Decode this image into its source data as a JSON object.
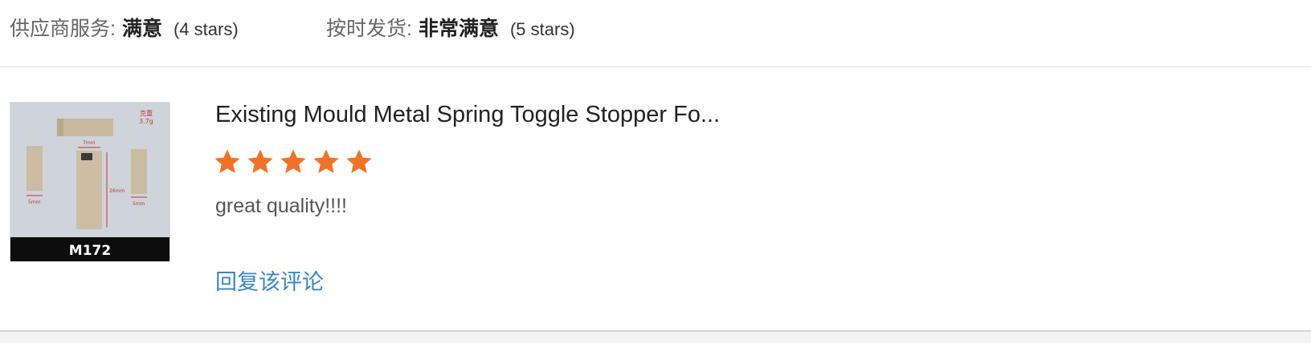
{
  "ratings": {
    "supplier_service": {
      "label": "供应商服务:",
      "value": "满意",
      "stars_text": "(4 stars)"
    },
    "on_time_delivery": {
      "label": "按时发货:",
      "value": "非常满意",
      "stars_text": "(5 stars)"
    }
  },
  "review": {
    "product_title": "Existing Mould Metal Spring Toggle Stopper Fo...",
    "rating_stars": 5,
    "rating_max": 5,
    "comment": "great quality!!!!",
    "reply_link": "回复该评论",
    "thumbnail": {
      "model_code": "M172",
      "note_line1": "克重",
      "note_line2": "3.7g",
      "dim_top": "7mm",
      "dim_side": "26mm",
      "dim_left": "5mm",
      "dim_right": "5mm"
    }
  },
  "colors": {
    "star": "#f07228",
    "link": "#3a86c7"
  }
}
